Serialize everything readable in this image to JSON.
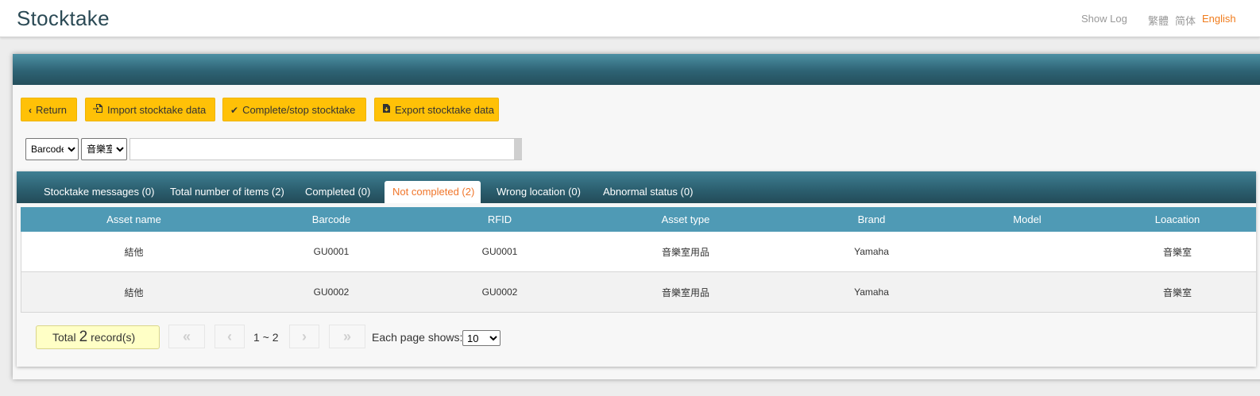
{
  "app": {
    "title": "Stocktake"
  },
  "header": {
    "show_log": "Show Log",
    "languages": [
      "繁體",
      "简体",
      "English"
    ],
    "active_language": "English"
  },
  "toolbar": {
    "return_label": "Return",
    "import_label": "Import stocktake data",
    "complete_label": "Complete/stop stocktake",
    "export_label": "Export stocktake data"
  },
  "search": {
    "field_select": "Barcode",
    "location_select": "音樂室",
    "value": ""
  },
  "tabs": [
    {
      "label": "Stocktake messages (0)"
    },
    {
      "label": "Total number of items (2)"
    },
    {
      "label": "Completed (0)"
    },
    {
      "label": "Not completed (2)"
    },
    {
      "label": "Wrong location (0)"
    },
    {
      "label": "Abnormal status (0)"
    }
  ],
  "active_tab": "Not completed (2)",
  "table": {
    "columns": [
      "Asset name",
      "Barcode",
      "RFID",
      "Asset type",
      "Brand",
      "Model",
      "Loacation"
    ],
    "rows": [
      [
        "結他",
        "GU0001",
        "GU0001",
        "音樂室用品",
        "Yamaha",
        "",
        "音樂室"
      ],
      [
        "結他",
        "GU0002",
        "GU0002",
        "音樂室用品",
        "Yamaha",
        "",
        "音樂室"
      ]
    ]
  },
  "pagination": {
    "total_prefix": "Total",
    "total_count": "2",
    "total_suffix": "record(s)",
    "range": "1 ~ 2",
    "page_size_label": "Each page shows:",
    "page_size": "10"
  },
  "colors": {
    "accent_button": "#ffc107",
    "header_teal": "#2e6374",
    "table_header": "#4f9ab5",
    "active_tab_text": "#f0752a",
    "active_language": "#f07c1c"
  }
}
